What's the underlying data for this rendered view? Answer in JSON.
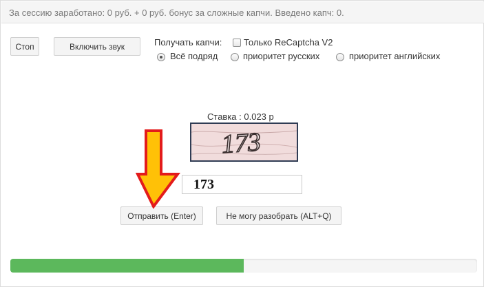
{
  "stats": {
    "text": "За сессию заработано: 0 руб. + 0 руб. бонус за сложные капчи. Введено капч: 0."
  },
  "controls": {
    "stop_label": "Стоп",
    "sound_label": "Включить звук",
    "receive_label": "Получать капчи:",
    "recaptcha_only_label": "Только ReCaptcha V2",
    "recaptcha_only_checked": false,
    "mode_options": [
      {
        "label": "Всё подряд",
        "checked": true
      },
      {
        "label": "приоритет русских",
        "checked": false
      },
      {
        "label": "приоритет английских",
        "checked": false
      }
    ]
  },
  "task": {
    "rate_text": "Ставка : 0.023 р",
    "captcha_text": "173",
    "answer_value": "173",
    "submit_label": "Отправить (Enter)",
    "cant_solve_label": "Не могу разобрать  (ALT+Q)"
  },
  "progress": {
    "fraction": 0.5
  },
  "colors": {
    "arrow_fill": "#ffc107",
    "arrow_stroke": "#e31b1b",
    "progress": "#5cb85c",
    "captcha_border": "#2f3c54"
  }
}
